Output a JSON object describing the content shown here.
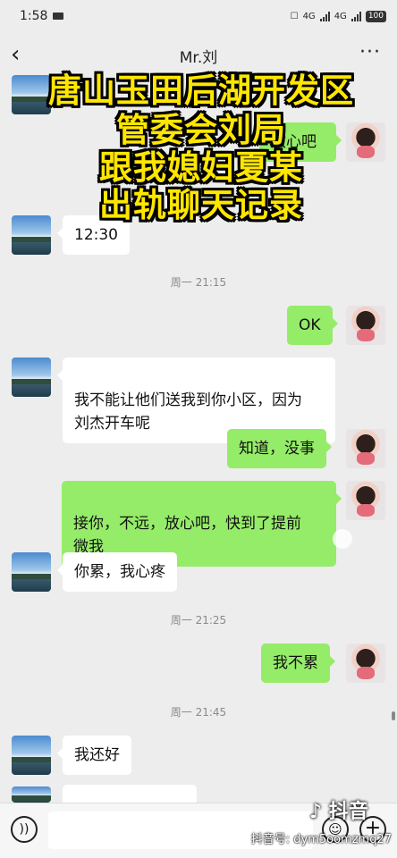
{
  "status_bar": {
    "time": "1:58",
    "signal_1": "4G",
    "signal_2": "4G",
    "battery": "100"
  },
  "header": {
    "title": "Mr.刘",
    "back_icon": "chevron-left-icon",
    "more_icon": "more-dots-icon"
  },
  "overlay_caption": [
    "唐山玉田后湖开发区",
    "管委会刘局",
    "跟我媳妇夏某",
    "出轨聊天记录"
  ],
  "messages": [
    {
      "side": "left",
      "text": ""
    },
    {
      "side": "right",
      "text": "放心吧"
    },
    {
      "side": "left",
      "text": "12:30"
    },
    {
      "type": "time",
      "text": "周一 21:15"
    },
    {
      "side": "right",
      "text": "OK"
    },
    {
      "side": "left",
      "text": "我不能让他们送我到你小区，因为\n刘杰开车呢"
    },
    {
      "side": "right",
      "text": "知道，没事"
    },
    {
      "side": "right",
      "text": "接你，不远，放心吧，快到了提前\n微我"
    },
    {
      "side": "left",
      "text": "你累，我心疼"
    },
    {
      "type": "time",
      "text": "周一 21:25"
    },
    {
      "side": "right",
      "text": "我不累"
    },
    {
      "type": "time",
      "text": "周一 21:45"
    },
    {
      "side": "left",
      "text": "我还好"
    }
  ],
  "input_bar": {
    "voice_icon": "voice-icon",
    "emoji_icon": "emoji-icon",
    "plus_icon": "plus-icon"
  },
  "watermark": {
    "logo_text": "抖音",
    "id_text": "抖音号: dym5oomzmq27"
  },
  "colors": {
    "chat_bg": "#ededed",
    "green_bubble": "#95ec69",
    "caption_yellow": "#ffe600"
  }
}
